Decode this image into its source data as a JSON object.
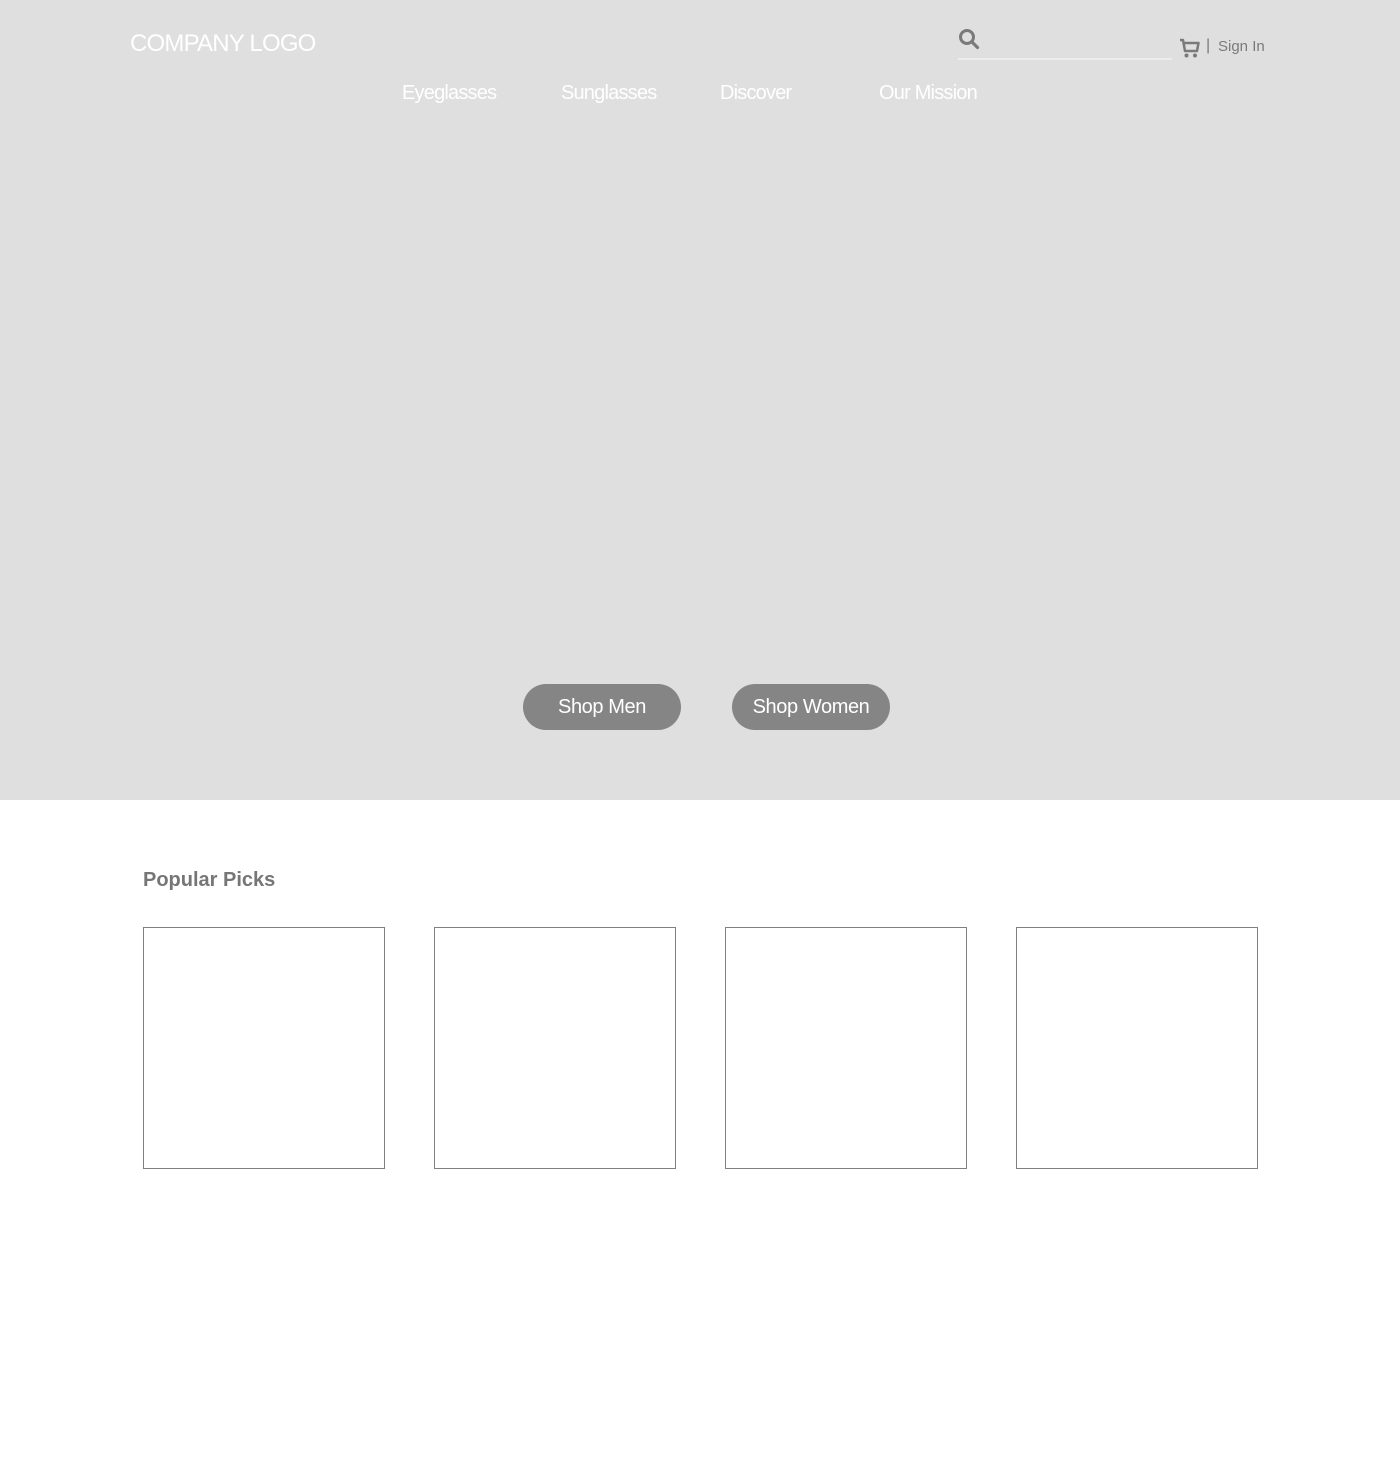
{
  "header": {
    "logo_text": "COMPANY LOGO",
    "search": {
      "placeholder": "",
      "value": "",
      "icon": "search-icon"
    },
    "cart_icon": "cart-icon",
    "divider": "|",
    "sign_in_label": "Sign In"
  },
  "nav": {
    "items": [
      {
        "label": "Eyeglasses"
      },
      {
        "label": "Sunglasses"
      },
      {
        "label": "Discover"
      },
      {
        "label": "Our Mission"
      }
    ]
  },
  "hero": {
    "buttons": [
      {
        "label": "Shop Men"
      },
      {
        "label": "Shop Women"
      }
    ]
  },
  "popular": {
    "title": "Popular Picks",
    "cards": [
      {},
      {},
      {},
      {}
    ]
  },
  "colors": {
    "hero_bg": "#dfdfdf",
    "button_bg": "#858585",
    "text_gray": "#767676",
    "card_border": "#808080"
  }
}
